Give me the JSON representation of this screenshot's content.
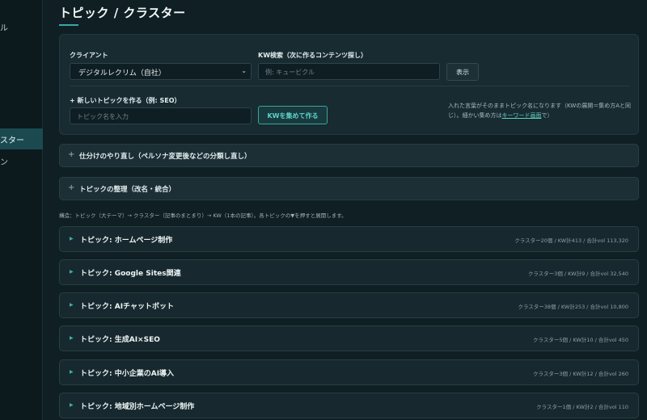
{
  "sidebar": {
    "frag_top": "ル",
    "active_label": "スター",
    "frag_next": "ン"
  },
  "page": {
    "title": "トピック / クラスター"
  },
  "form": {
    "client_label": "クライアント",
    "client_value": "デジタルレクリム（自社）",
    "kw_search_label": "KW検索（次に作るコンテンツ探し）",
    "kw_search_placeholder": "例: キュービクル",
    "show_button": "表示",
    "new_topic_label": "+ 新しいトピックを作る（例: SEO）",
    "topic_name_placeholder": "トピック名を入力",
    "collect_button": "KWを集めて作る",
    "note_text": "入れた言葉がそのままトピック名になります（KWの展開＝集め方Aと同じ）。細かい集め方は",
    "note_link": "キーワード画面",
    "note_suffix": "で）"
  },
  "accordions": [
    {
      "label": "仕分けのやり直し（ペルソナ変更後などの分類し直し）"
    },
    {
      "label": "トピックの整理（改名・統合）"
    }
  ],
  "hierarchy_note": "構造：トピック（大テーマ）→ クラスター（記事のまとまり）→ KW（1本の記事）。各トピックの▼を押すと展開します。",
  "topics": [
    {
      "name": "トピック: ホームページ制作",
      "stats": "クラスター20個 / KW計413 / 合計vol 113,320"
    },
    {
      "name": "トピック: Google Sites関連",
      "stats": "クラスター3個 / KW計9 / 合計vol 32,540"
    },
    {
      "name": "トピック: AIチャットボット",
      "stats": "クラスター38個 / KW計253 / 合計vol 10,800"
    },
    {
      "name": "トピック: 生成AI×SEO",
      "stats": "クラスター5個 / KW計10 / 合計vol 450"
    },
    {
      "name": "トピック: 中小企業のAI導入",
      "stats": "クラスター3個 / KW計12 / 合計vol 260"
    },
    {
      "name": "トピック: 地域別ホームページ制作",
      "stats": "クラスター1個 / KW計2 / 合計vol 110"
    }
  ]
}
